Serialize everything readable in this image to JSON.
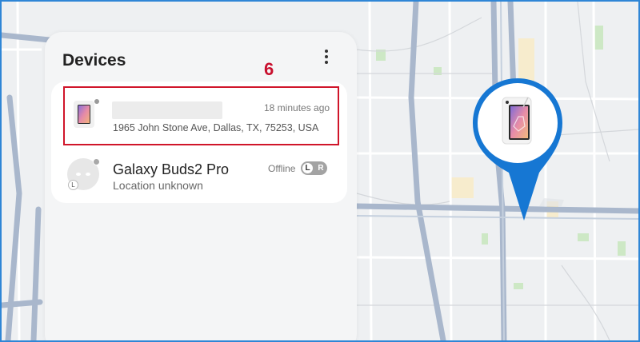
{
  "panel": {
    "title": "Devices",
    "more_icon": "more-vertical-icon"
  },
  "annotation": {
    "label": "6",
    "color": "#c8102e"
  },
  "devices": [
    {
      "icon": "tablet-icon",
      "name": "",
      "time": "18 minutes ago",
      "address": "1965 John Stone Ave, Dallas, TX, 75253, USA",
      "status_color": "#9a9a9a"
    },
    {
      "icon": "earbuds-icon",
      "name": "Galaxy Buds2 Pro",
      "location": "Location unknown",
      "status": "Offline",
      "badge_left": "L",
      "badge_right": "R",
      "sub_badge": "L"
    }
  ],
  "map": {
    "pin_icon": "tablet-location-pin-icon",
    "pin_color": "#1677d3"
  }
}
